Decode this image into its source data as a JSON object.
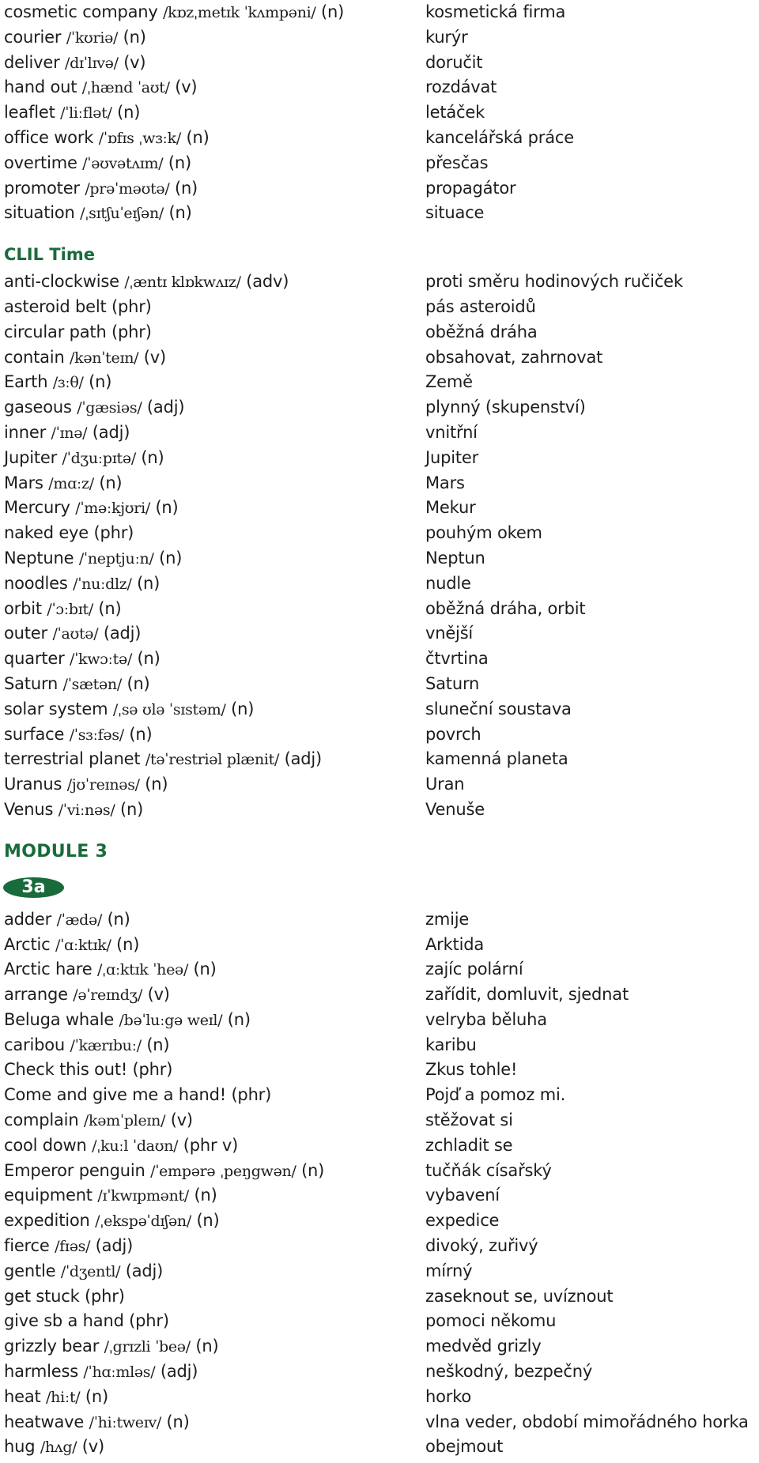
{
  "colors": {
    "accent": "#1a6b3c",
    "text": "#1d1d1b"
  },
  "section1": {
    "entries": [
      {
        "word": "cosmetic company",
        "ipa": "/kɒzˌmetɪk ˈkʌmpəni/",
        "pos": "(n)",
        "cz": "kosmetická firma"
      },
      {
        "word": "courier",
        "ipa": "/ˈkʊriə/",
        "pos": "(n)",
        "cz": "kurýr"
      },
      {
        "word": "deliver",
        "ipa": "/dɪˈlɪvə/",
        "pos": "(v)",
        "cz": "doručit"
      },
      {
        "word": "hand out",
        "ipa": "/ˌhænd ˈaʊt/",
        "pos": "(v)",
        "cz": "rozdávat"
      },
      {
        "word": "leaflet",
        "ipa": "/ˈliːflət/",
        "pos": "(n)",
        "cz": "letáček"
      },
      {
        "word": "office work",
        "ipa": "/ˈɒfɪs ˌwɜːk/",
        "pos": "(n)",
        "cz": "kancelářská práce"
      },
      {
        "word": "overtime",
        "ipa": "/ˈəʊvətʌɪm/",
        "pos": "(n)",
        "cz": "přesčas"
      },
      {
        "word": "promoter",
        "ipa": "/prəˈməʊtə/",
        "pos": "(n)",
        "cz": "propagátor"
      },
      {
        "word": "situation",
        "ipa": "/ˌsɪtʃuˈeɪʃən/",
        "pos": "(n)",
        "cz": "situace"
      }
    ]
  },
  "clil": {
    "title": "CLIL Time",
    "entries": [
      {
        "word": "anti-clockwise",
        "ipa": "/ˌæntɪ klɒkwʌɪz/",
        "pos": "(adv)",
        "cz": "proti směru hodinových ručiček"
      },
      {
        "word": "asteroid belt (phr)",
        "ipa": "",
        "pos": "",
        "cz": "pás asteroidů"
      },
      {
        "word": "circular path (phr)",
        "ipa": "",
        "pos": "",
        "cz": "oběžná dráha"
      },
      {
        "word": "contain",
        "ipa": "/kənˈteɪn/",
        "pos": "(v)",
        "cz": "obsahovat, zahrnovat"
      },
      {
        "word": "Earth",
        "ipa": "/ɜːθ/",
        "pos": "(n)",
        "cz": "Země"
      },
      {
        "word": "gaseous",
        "ipa": "/ˈgæsiəs/",
        "pos": "(adj)",
        "cz": "plynný (skupenství)"
      },
      {
        "word": "inner",
        "ipa": "/ˈɪnə/",
        "pos": "(adj)",
        "cz": "vnitřní"
      },
      {
        "word": "Jupiter",
        "ipa": "/ˈdʒuːpɪtə/",
        "pos": "(n)",
        "cz": "Jupiter"
      },
      {
        "word": "Mars",
        "ipa": "/mɑːz/",
        "pos": "(n)",
        "cz": "Mars"
      },
      {
        "word": "Mercury",
        "ipa": "/ˈməːkjʊri/",
        "pos": "(n)",
        "cz": "Mekur"
      },
      {
        "word": "naked eye (phr)",
        "ipa": "",
        "pos": "",
        "cz": "pouhým okem"
      },
      {
        "word": "Neptune",
        "ipa": "/ˈneptjuːn/",
        "pos": "(n)",
        "cz": "Neptun"
      },
      {
        "word": "noodles",
        "ipa": "/ˈnuːdlz/",
        "pos": "(n)",
        "cz": "nudle"
      },
      {
        "word": "orbit",
        "ipa": "/ˈɔːbɪt/",
        "pos": "(n)",
        "cz": "oběžná dráha, orbit"
      },
      {
        "word": "outer",
        "ipa": "/ˈaʊtə/",
        "pos": "(adj)",
        "cz": "vnější"
      },
      {
        "word": "quarter",
        "ipa": "/ˈkwɔːtə/",
        "pos": "(n)",
        "cz": "čtvrtina"
      },
      {
        "word": "Saturn",
        "ipa": "/ˈsætən/",
        "pos": "(n)",
        "cz": "Saturn"
      },
      {
        "word": "solar system",
        "ipa": "/ˌsə ʊlə ˈsɪstəm/",
        "pos": "(n)",
        "cz": "sluneční soustava"
      },
      {
        "word": "surface",
        "ipa": "/ˈsɜːfəs/",
        "pos": "(n)",
        "cz": "povrch"
      },
      {
        "word": "terrestrial planet",
        "ipa": "/təˈrestriəl plænit/",
        "pos": "(adj)",
        "cz": "kamenná planeta"
      },
      {
        "word": "Uranus",
        "ipa": "/jʊˈreɪnəs/",
        "pos": "(n)",
        "cz": "Uran"
      },
      {
        "word": "Venus",
        "ipa": "/ˈviːnəs/",
        "pos": "(n)",
        "cz": "Venuše"
      }
    ]
  },
  "module3": {
    "title": "MODULE 3",
    "badge": "3a",
    "entries": [
      {
        "word": "adder",
        "ipa": "/ˈædə/",
        "pos": "(n)",
        "cz": "zmije"
      },
      {
        "word": "Arctic",
        "ipa": "/ˈɑːktɪk/",
        "pos": "(n)",
        "cz": "Arktida"
      },
      {
        "word": "Arctic hare",
        "ipa": "/ˌɑːktɪk ˈheə/",
        "pos": "(n)",
        "cz": "zajíc polární"
      },
      {
        "word": "arrange",
        "ipa": "/əˈreɪndʒ/",
        "pos": "(v)",
        "cz": "zařídit, domluvit, sjednat"
      },
      {
        "word": "Beluga whale",
        "ipa": "/bəˈluːgə weɪl/",
        "pos": "(n)",
        "cz": "velryba běluha"
      },
      {
        "word": "caribou",
        "ipa": "/ˈkærɪbuː/",
        "pos": "(n)",
        "cz": "karibu"
      },
      {
        "word": "Check this out! (phr)",
        "ipa": "",
        "pos": "",
        "cz": "Zkus tohle!"
      },
      {
        "word": "Come and give me a hand! (phr)",
        "ipa": "",
        "pos": "",
        "cz": "Pojď a pomoz mi."
      },
      {
        "word": "complain",
        "ipa": "/kəmˈpleɪn/",
        "pos": "(v)",
        "cz": "stěžovat si"
      },
      {
        "word": "cool down",
        "ipa": "/ˌkuːl ˈdaʊn/",
        "pos": "(phr v)",
        "cz": "zchladit se"
      },
      {
        "word": "Emperor penguin",
        "ipa": "/ˈempərə ˌpeŋgwən/",
        "pos": "(n)",
        "cz": "tučňák císařský"
      },
      {
        "word": "equipment",
        "ipa": "/ɪˈkwɪpmənt/",
        "pos": "(n)",
        "cz": "vybavení"
      },
      {
        "word": "expedition",
        "ipa": "/ˌekspəˈdɪʃən/",
        "pos": "(n)",
        "cz": "expedice"
      },
      {
        "word": "fierce",
        "ipa": "/fɪəs/",
        "pos": "(adj)",
        "cz": "divoký, zuřivý"
      },
      {
        "word": "gentle",
        "ipa": "/ˈdʒentl/",
        "pos": "(adj)",
        "cz": "mírný"
      },
      {
        "word": "get stuck (phr)",
        "ipa": "",
        "pos": "",
        "cz": "zaseknout se, uvíznout"
      },
      {
        "word": "give sb a hand (phr)",
        "ipa": "",
        "pos": "",
        "cz": "pomoci někomu"
      },
      {
        "word": "grizzly bear",
        "ipa": "/ˌgrɪzli ˈbeə/",
        "pos": "(n)",
        "cz": "medvěd grizly"
      },
      {
        "word": "harmless",
        "ipa": "/ˈhɑːmləs/",
        "pos": "(adj)",
        "cz": "neškodný, bezpečný"
      },
      {
        "word": "heat",
        "ipa": "/hiːt/",
        "pos": "(n)",
        "cz": "horko"
      },
      {
        "word": "heatwave",
        "ipa": "/ˈhiːtweɪv/",
        "pos": "(n)",
        "cz": "vlna veder, období mimořádného horka"
      },
      {
        "word": "hug",
        "ipa": "/hʌg/",
        "pos": "(v)",
        "cz": "obejmout"
      }
    ]
  }
}
